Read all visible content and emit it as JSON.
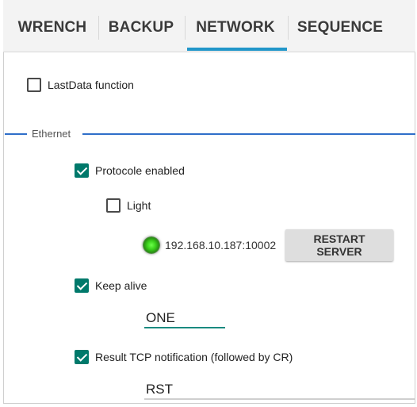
{
  "tabs": [
    {
      "label": "WRENCH",
      "active": false
    },
    {
      "label": "BACKUP",
      "active": false
    },
    {
      "label": "NETWORK",
      "active": true
    },
    {
      "label": "SEQUENCE",
      "active": false
    }
  ],
  "lastdata": {
    "label": "LastData function",
    "checked": false
  },
  "ethernet": {
    "title": "Ethernet",
    "protocole": {
      "label": "Protocole enabled",
      "checked": true
    },
    "light": {
      "label": "Light",
      "checked": false
    },
    "server": {
      "address": "192.168.10.187:10002",
      "restart_label": "RESTART SERVER",
      "status": "connected"
    },
    "keep_alive": {
      "label": "Keep alive",
      "checked": true,
      "value": "ONE"
    },
    "result_tcp": {
      "label": "Result TCP notification (followed by CR)",
      "checked": true,
      "value": "RST"
    }
  },
  "colors": {
    "accent": "#2196c9",
    "section": "#2f6fc9",
    "checkbox": "#00796b",
    "status_led": "#3ad01b"
  }
}
